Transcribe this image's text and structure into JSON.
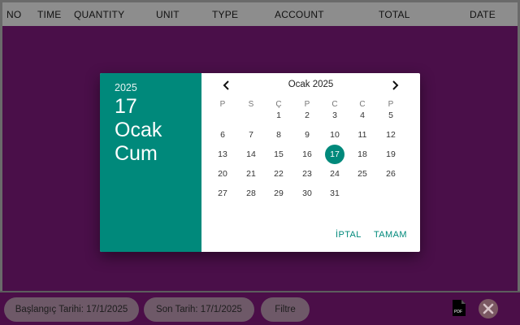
{
  "table": {
    "columns": [
      "NO",
      "TIME",
      "QUANTITY",
      "UNIT",
      "TYPE",
      "ACCOUNT",
      "TOTAL",
      "DATE"
    ]
  },
  "dialog": {
    "year": "2025",
    "date_line1": "17",
    "date_line2": "Ocak",
    "date_line3": "Cum",
    "month_title": "Ocak 2025",
    "weekdays": [
      "P",
      "S",
      "Ç",
      "P",
      "C",
      "C",
      "P"
    ],
    "first_weekday_index": 2,
    "days_in_month": 31,
    "selected_day": 17,
    "cancel_label": "İPTAL",
    "ok_label": "TAMAM",
    "accent_color": "#00897b"
  },
  "footer": {
    "start_date_label": "Başlangıç Tarihi: 17/1/2025",
    "end_date_label": "Son Tarih: 17/1/2025",
    "filter_label": "Filtre",
    "pdf_icon": "pdf-file-icon",
    "close_icon": "close-x-icon"
  }
}
